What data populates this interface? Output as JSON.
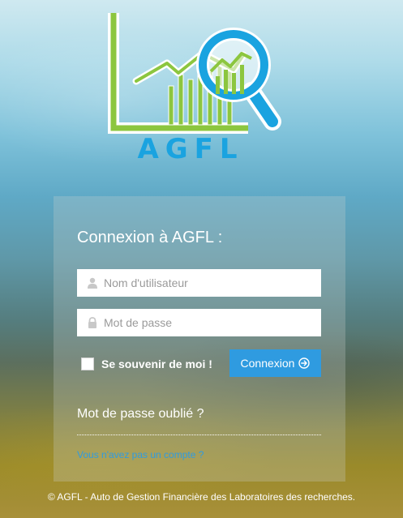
{
  "logo": {
    "text": "AGFL",
    "icon": "chart-magnifier-logo",
    "colors": {
      "green": "#8cc63f",
      "blue": "#1aa3e0"
    }
  },
  "login": {
    "title": "Connexion à AGFL :",
    "username": {
      "placeholder": "Nom d'utilisateur",
      "value": "",
      "icon": "user-icon"
    },
    "password": {
      "placeholder": "Mot de passe",
      "value": "",
      "icon": "lock-icon"
    },
    "remember_label": "Se souvenir de moi !",
    "remember_checked": false,
    "submit_label": "Connexion",
    "submit_icon": "arrow-circle-right-icon",
    "forgot_password": "Mot de passe oublié ?",
    "no_account": "Vous n'avez pas un compte ?"
  },
  "footer": {
    "text": "© AGFL - Auto de Gestion Financière des Laboratoires des recherches."
  },
  "colors": {
    "accent": "#2f9be0",
    "panel": "rgba(200,210,205,0.28)"
  }
}
